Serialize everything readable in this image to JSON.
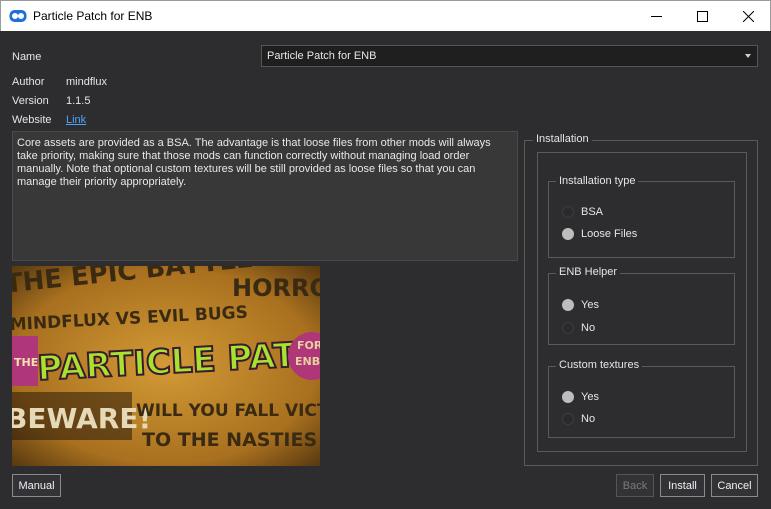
{
  "window": {
    "title": "Particle Patch for ENB"
  },
  "info": {
    "name_label": "Name",
    "name_value": "Particle Patch for ENB",
    "author_label": "Author",
    "author_value": "mindflux",
    "version_label": "Version",
    "version_value": "1.1.5",
    "website_label": "Website",
    "website_link": "Link"
  },
  "description": "Core assets are provided as a BSA. The advantage is that loose files from other mods will always take priority, making sure that those mods can function correctly without managing load order manually. Note that optional custom textures will be still provided as loose files so that you can manage their priority appropriately.",
  "banner": {
    "line1": "THE EPIC BATTLE",
    "line1b": "HORRO",
    "line2": "MINDFLUX VS EVIL BUGS",
    "line3": "PARTICLE PATCH",
    "badge_top": "FOR",
    "badge_bottom": "ENB",
    "the": "THE",
    "line4": "BEWARE!",
    "line5": "WILL YOU FALL VICTI",
    "line6": "TO THE NASTIES"
  },
  "installation": {
    "title": "Installation",
    "groups": [
      {
        "title": "Installation type",
        "options": [
          {
            "label": "BSA",
            "selected": false
          },
          {
            "label": "Loose Files",
            "selected": true
          }
        ]
      },
      {
        "title": "ENB Helper",
        "options": [
          {
            "label": "Yes",
            "selected": true
          },
          {
            "label": "No",
            "selected": false
          }
        ]
      },
      {
        "title": "Custom textures",
        "options": [
          {
            "label": "Yes",
            "selected": true
          },
          {
            "label": "No",
            "selected": false
          }
        ]
      }
    ]
  },
  "buttons": {
    "manual": "Manual",
    "back": "Back",
    "install": "Install",
    "cancel": "Cancel"
  },
  "colors": {
    "background": "#2d2d30",
    "link": "#4aa3ff",
    "banner_green": "#a6e22e",
    "banner_purple": "#b0367a"
  }
}
